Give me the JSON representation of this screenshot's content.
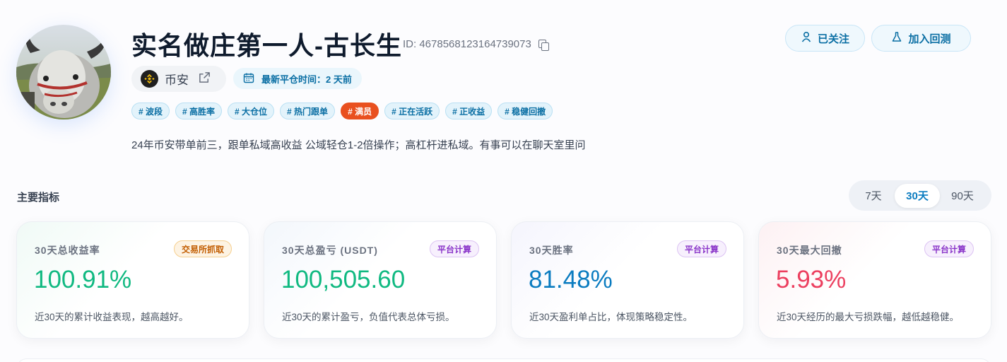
{
  "profile": {
    "name": "实名做庄第一人-古长生",
    "uid": "ID: 4678568123164739073",
    "exchange": "币安",
    "last_close_label": "最新平仓时间：",
    "last_close_value": "2 天前",
    "bio": "24年币安带单前三，跟单私域高收益 公域轻仓1-2倍操作；高杠杆进私域。有事可以在聊天室里问"
  },
  "actions": {
    "follow": "已关注",
    "backtest": "加入回测"
  },
  "tags": [
    "# 波段",
    "# 高胜率",
    "# 大仓位",
    "# 热门跟单",
    "# 满员",
    "# 正在活跃",
    "# 正收益",
    "# 稳健回撤"
  ],
  "metrics": {
    "title": "主要指标",
    "ranges": [
      "7天",
      "30天",
      "90天"
    ],
    "selected_range": "30天",
    "cards": [
      {
        "label": "30天总收益率",
        "badge": "交易所抓取",
        "value": "100.91%",
        "desc": "近30天的累计收益表现，越高越好。",
        "color": "#10b981"
      },
      {
        "label": "30天总盈亏 (USDT)",
        "badge": "平台计算",
        "value": "100,505.60",
        "desc": "近30天的累计盈亏，负值代表总体亏损。",
        "color": "#10b981"
      },
      {
        "label": "30天胜率",
        "badge": "平台计算",
        "value": "81.48%",
        "desc": "近30天盈利单占比，体现策略稳定性。",
        "color": "#0b7cc0"
      },
      {
        "label": "30天最大回撤",
        "badge": "平台计算",
        "value": "5.93%",
        "desc": "近30天经历的最大亏损跌幅，越低越稳健。",
        "color": "#ec3f5f"
      }
    ]
  },
  "icons": {
    "avatar": "yak-avatar",
    "copy": "copy-icon",
    "follow": "user-icon",
    "backtest": "flask-icon",
    "exchange": "binance-icon",
    "external": "external-link-icon",
    "calendar": "calendar-icon"
  }
}
